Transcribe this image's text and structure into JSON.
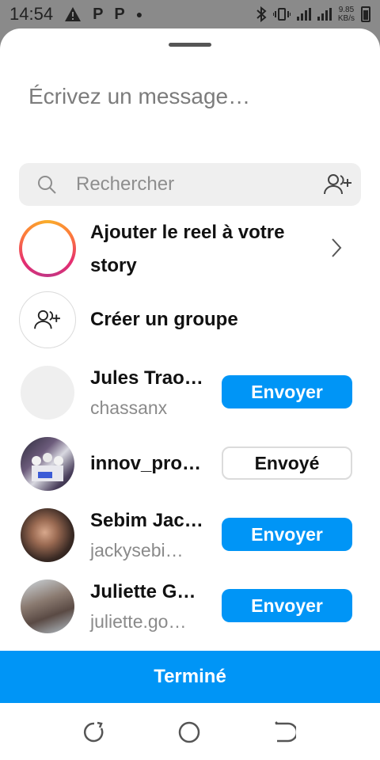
{
  "status_bar": {
    "time": "14:54",
    "left_icons": [
      "warning-icon",
      "p-icon",
      "p-icon",
      "dot-icon"
    ],
    "speed_value": "9.85",
    "speed_unit": "KB/s"
  },
  "share_sheet": {
    "message_placeholder": "Écrivez un message…",
    "search_placeholder": "Rechercher",
    "add_story": {
      "label_line1": "Ajouter le reel à votre",
      "label_line2": "story"
    },
    "create_group": {
      "label": "Créer un groupe"
    },
    "contacts": [
      {
        "name": "Jules Trao…",
        "username": "chassanx",
        "button": "Envoyer",
        "sent": false
      },
      {
        "name": "innov_pro…",
        "username": "",
        "button": "Envoyé",
        "sent": true
      },
      {
        "name": "Sebim Jac…",
        "username": "jackysebi…",
        "button": "Envoyer",
        "sent": false
      },
      {
        "name": "Juliette G…",
        "username": "juliette.go…",
        "button": "Envoyer",
        "sent": false
      }
    ],
    "done_label": "Terminé"
  },
  "colors": {
    "accent": "#0095f6",
    "sheet": "#ffffff",
    "scrim": "#8a8a8a"
  }
}
